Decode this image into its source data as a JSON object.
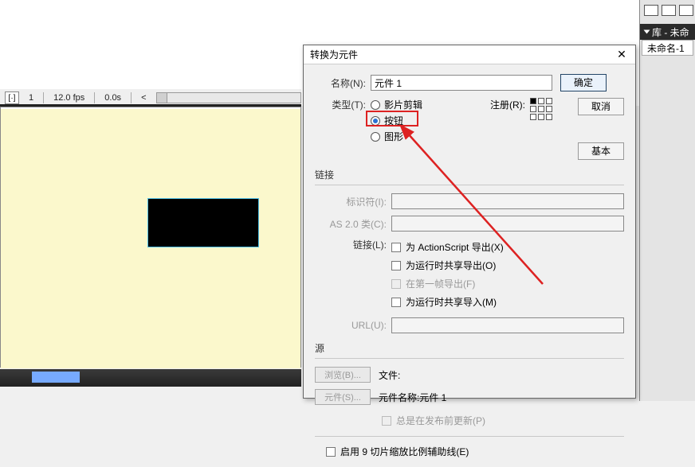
{
  "toolbar": {
    "bracket_icon": "[·]",
    "frame": "1",
    "fps": "12.0 fps",
    "time": "0.0s",
    "scroll_left": "<"
  },
  "right_panel": {
    "library_label": "库 - 未命",
    "doc_name": "未命名-1"
  },
  "dialog": {
    "title": "转换为元件",
    "close": "✕",
    "name_label": "名称(N):",
    "name_value": "元件 1",
    "ok": "确定",
    "cancel": "取消",
    "basic": "基本",
    "type_label": "类型(T):",
    "type_options": {
      "movie": "影片剪辑",
      "button": "按钮",
      "graphic": "图形"
    },
    "register_label": "注册(R):",
    "link_header": "链接",
    "identifier_label": "标识符(I):",
    "as2class_label": "AS 2.0 类(C):",
    "linkage_label": "链接(L):",
    "linkage_chk": {
      "as_export": "为 ActionScript 导出(X)",
      "rt_export": "为运行时共享导出(O)",
      "first_frame": "在第一帧导出(F)",
      "rt_import": "为运行时共享导入(M)"
    },
    "url_label": "URL(U):",
    "source_header": "源",
    "browse_btn": "浏览(B)...",
    "file_label": "文件:",
    "symbol_btn": "元件(S)...",
    "symbol_name_label": "元件名称:元件 1",
    "always_update": "总是在发布前更新(P)",
    "enable_9slice": "启用 9 切片缩放比例辅助线(E)"
  }
}
